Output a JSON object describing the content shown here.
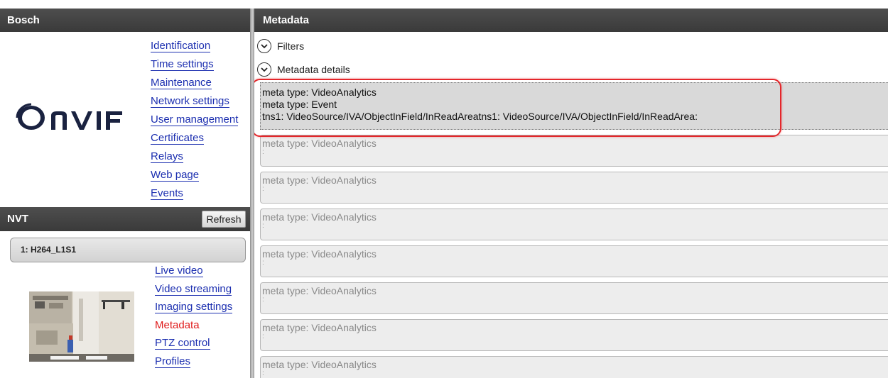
{
  "left": {
    "bosch_title": "Bosch",
    "device_nav": [
      {
        "label": "Identification"
      },
      {
        "label": "Time settings"
      },
      {
        "label": "Maintenance"
      },
      {
        "label": "Network settings"
      },
      {
        "label": "User management"
      },
      {
        "label": "Certificates"
      },
      {
        "label": "Relays"
      },
      {
        "label": "Web page"
      },
      {
        "label": "Events"
      }
    ],
    "logo_text": "ONVIF",
    "nvt_title": "NVT",
    "refresh_label": "Refresh",
    "stream": "1: H264_L1S1",
    "nvt_nav": [
      {
        "label": "Live video"
      },
      {
        "label": "Video streaming"
      },
      {
        "label": "Imaging settings"
      },
      {
        "label": "Metadata",
        "active": true
      },
      {
        "label": "PTZ control"
      },
      {
        "label": "Profiles"
      }
    ]
  },
  "right": {
    "title": "Metadata",
    "filters_label": "Filters",
    "details_label": "Metadata details",
    "selected_entry": {
      "line1": "meta type: VideoAnalytics",
      "line2": "meta type: Event",
      "line3": "tns1: VideoSource/IVA/ObjectInField/InReadAreatns1: VideoSource/IVA/ObjectInField/InReadArea:"
    },
    "entries": [
      {
        "text": "meta type: VideoAnalytics",
        "suffix": ":"
      },
      {
        "text": "meta type: VideoAnalytics",
        "suffix": ":"
      },
      {
        "text": "meta type: VideoAnalytics",
        "suffix": ":"
      },
      {
        "text": "meta type: VideoAnalytics",
        "suffix": ":"
      },
      {
        "text": "meta type: VideoAnalytics",
        "suffix": ":"
      },
      {
        "text": "meta type: VideoAnalytics",
        "suffix": ":"
      },
      {
        "text": "meta type: VideoAnalytics",
        "suffix": ":"
      }
    ]
  },
  "colors": {
    "link": "#1c2fb0",
    "active_link": "#e01c1c",
    "highlight": "#e4262a",
    "header_bg": "#444444"
  }
}
